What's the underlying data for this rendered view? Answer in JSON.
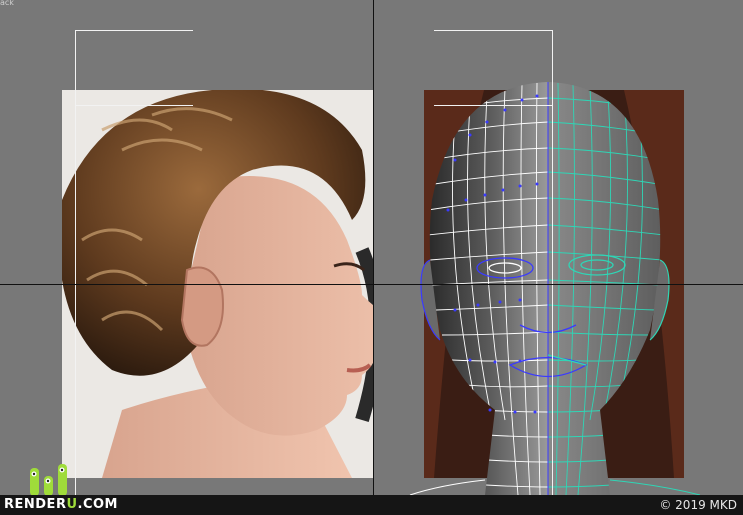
{
  "viewport": {
    "corner_label": "ack"
  },
  "watermark": {
    "brand_prefix": "RENDER",
    "brand_accent": "U",
    "brand_suffix": ".COM",
    "copyright": "© 2019 MKD"
  },
  "colors": {
    "background": "#787878",
    "frame": "#f2f2f2",
    "crosshair": "#111111",
    "mesh_left": "#ffffff",
    "mesh_vertex": "#3a3aff",
    "mesh_right": "#2fd6b6",
    "brand_accent": "#9fdc3a"
  }
}
